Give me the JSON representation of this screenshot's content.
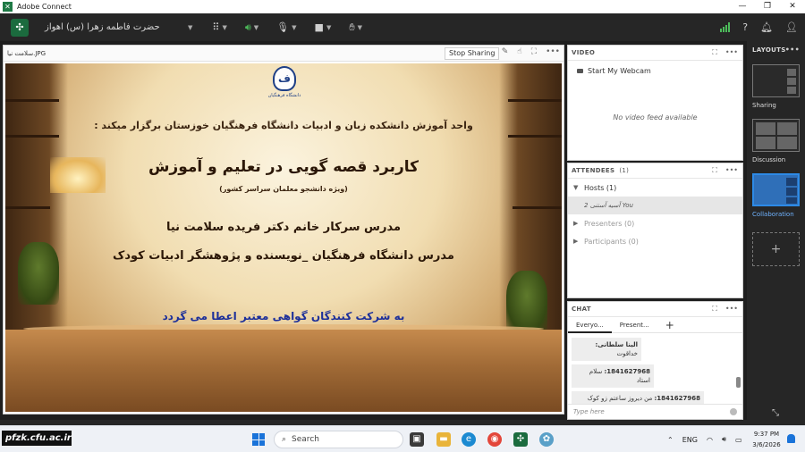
{
  "window": {
    "title": "Adobe Connect",
    "minimize": "—",
    "maximize": "❐",
    "close": "✕"
  },
  "toolbar": {
    "room_name": "حضرت فاطمه زهرا (س) اهواز",
    "icons": {
      "apps": "grid-icon",
      "mic_on": "speaker-icon",
      "mic": "microphone-icon",
      "camera": "camera-icon",
      "hand": "raise-hand-icon"
    },
    "status_color": "#4cbb5a"
  },
  "share": {
    "file_name": "سلامت نیا.JPG",
    "stop_label": "Stop Sharing",
    "slide": {
      "logo_label": "دانشگاه فرهنگیان",
      "line1": "واحد آموزش دانشکده زبان و ادبیات دانشگاه فرهنگیان خوزستان برگزار میکند :",
      "line2": "کاربرد قصه گویی در تعلیم و آموزش",
      "line3": "(ویژه دانشجو معلمان سراسر کشور)",
      "line4": "مدرس  سرکار خانم دکتر فریده سلامت نیا",
      "line5": "مدرس دانشگاه فرهنگیان _نویسنده و پژوهشگر ادبیات کودک",
      "line6": "به شرکت کنندگان گواهی معتبر اعطا می گردد"
    }
  },
  "video": {
    "title": "VIDEO",
    "webcam_label": "Start My Webcam",
    "empty_text": "No video feed available"
  },
  "attendees": {
    "title": "ATTENDEES",
    "count": "(1)",
    "hosts_label": "Hosts (1)",
    "you_entry": "آسیه آستنی 2 You",
    "presenters_label": "Presenters (0)",
    "participants_label": "Participants (0)"
  },
  "chat": {
    "title": "CHAT",
    "tabs": [
      "Everyo...",
      "Present..."
    ],
    "add_tab": "+",
    "messages": [
      {
        "sender": "الینا سلطانی:",
        "text": " خداقوت"
      },
      {
        "sender": "1841627968:",
        "text": " سلام استاد"
      },
      {
        "sender": "1841627968:",
        "text": " من دیروز ساعتم زو کوک کرده بودم برای وبینار ولی فراموش کردم"
      }
    ],
    "placeholder": "Type here"
  },
  "layouts": {
    "title": "LAYOUTS",
    "items": [
      {
        "label": "Sharing",
        "active": false
      },
      {
        "label": "Discussion",
        "active": false
      },
      {
        "label": "Collaboration",
        "active": true
      }
    ],
    "add": "+",
    "accent_color": "#2d8ae6"
  },
  "taskbar": {
    "watermark": "pfzk.cfu.ac.ir",
    "search_label": "Search",
    "language": "ENG",
    "time": "9:37 PM",
    "date": "3/6/2026"
  }
}
